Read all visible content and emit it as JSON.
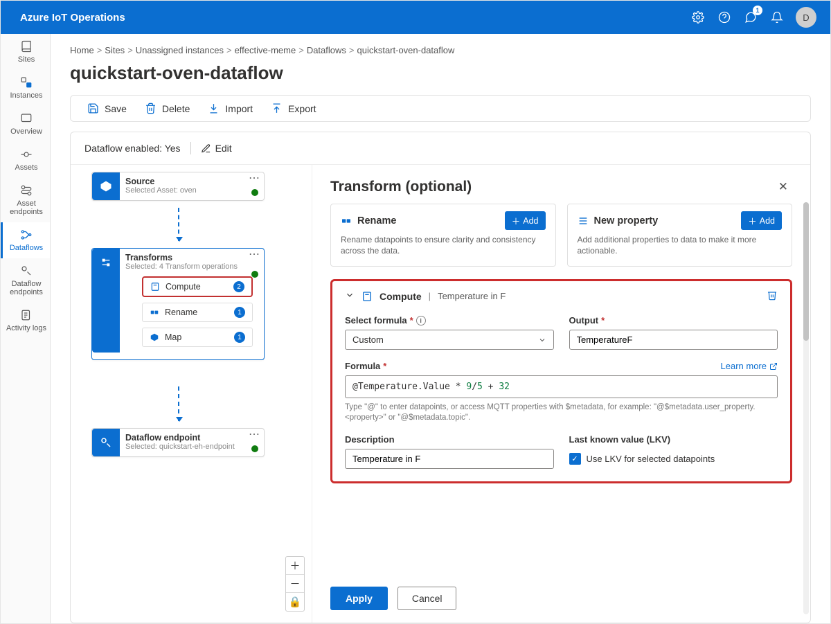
{
  "header": {
    "product": "Azure IoT Operations",
    "notification_count": "1",
    "avatar_initial": "D"
  },
  "sidebar": {
    "items": [
      {
        "label": "Sites"
      },
      {
        "label": "Instances"
      },
      {
        "label": "Overview"
      },
      {
        "label": "Assets"
      },
      {
        "label": "Asset endpoints"
      },
      {
        "label": "Dataflows"
      },
      {
        "label": "Dataflow endpoints"
      },
      {
        "label": "Activity logs"
      }
    ]
  },
  "breadcrumb": {
    "items": [
      "Home",
      "Sites",
      "Unassigned instances",
      "effective-meme",
      "Dataflows",
      "quickstart-oven-dataflow"
    ]
  },
  "page": {
    "title": "quickstart-oven-dataflow"
  },
  "commands": {
    "save": "Save",
    "delete": "Delete",
    "import": "Import",
    "export": "Export"
  },
  "status": {
    "enabled_label": "Dataflow enabled:",
    "enabled_value": "Yes",
    "edit": "Edit"
  },
  "graph": {
    "source": {
      "title": "Source",
      "subtitle": "Selected Asset: oven"
    },
    "transforms": {
      "title": "Transforms",
      "subtitle": "Selected: 4 Transform operations",
      "items": [
        {
          "label": "Compute",
          "count": "2"
        },
        {
          "label": "Rename",
          "count": "1"
        },
        {
          "label": "Map",
          "count": "1"
        }
      ]
    },
    "endpoint": {
      "title": "Dataflow endpoint",
      "subtitle": "Selected: quickstart-eh-endpoint"
    }
  },
  "panel": {
    "title": "Transform (optional)",
    "rename": {
      "title": "Rename",
      "add": "Add",
      "desc": "Rename datapoints to ensure clarity and consistency across the data."
    },
    "newprop": {
      "title": "New property",
      "add": "Add",
      "desc": "Add additional properties to data to make it more actionable."
    },
    "compute": {
      "head_type": "Compute",
      "head_name": "Temperature in F",
      "select_formula_label": "Select formula",
      "select_formula_value": "Custom",
      "output_label": "Output",
      "output_value": "TemperatureF",
      "formula_label": "Formula",
      "learn_more": "Learn more",
      "formula_hint": "Type \"@\" to enter datapoints, or access MQTT properties with $metadata, for example: \"@$metadata.user_property.<property>\" or \"@$metadata.topic\".",
      "description_label": "Description",
      "description_value": "Temperature in F",
      "lkv_label": "Last known value (LKV)",
      "lkv_checkbox": "Use LKV for selected datapoints",
      "formula_parts": {
        "p1": "@Temperature.Value",
        "op1": " * ",
        "n1": "9",
        "op2": "/",
        "n2": "5",
        "op3": " + ",
        "n3": "32"
      }
    },
    "footer": {
      "apply": "Apply",
      "cancel": "Cancel"
    }
  },
  "zoom": {
    "plus": "＋",
    "minus": "－",
    "lock": "🔒"
  }
}
